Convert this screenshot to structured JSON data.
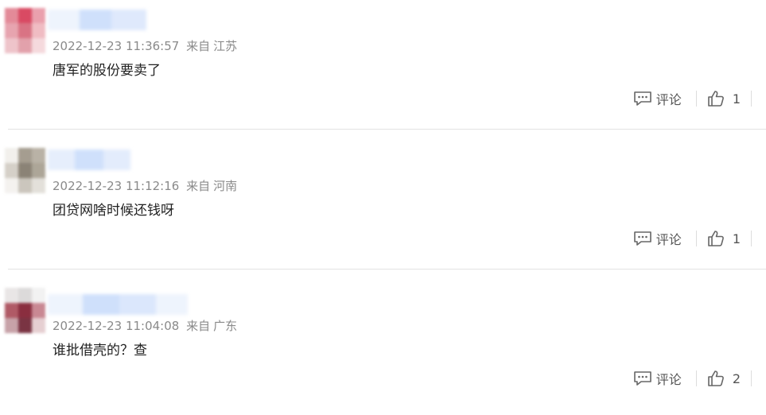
{
  "comments": [
    {
      "timestamp": "2022-12-23 11:36:57",
      "source_prefix": "来自",
      "location": "江苏",
      "text": "唐军的股份要卖了",
      "reply_label": "评论",
      "like_count": "1",
      "avatar_colors": [
        "#e38a98",
        "#d94a63",
        "#eaa0ad",
        "#e7a4af",
        "#d97384",
        "#f0bcc3",
        "#eec4ca",
        "#e2a1ab",
        "#f5d9dd"
      ]
    },
    {
      "timestamp": "2022-12-23 11:12:16",
      "source_prefix": "来自",
      "location": "河南",
      "text": "团贷网啥时候还钱呀",
      "reply_label": "评论",
      "like_count": "1",
      "avatar_colors": [
        "#f2f0ec",
        "#a59d90",
        "#b9b2a6",
        "#d5d0c8",
        "#8b8376",
        "#ada698",
        "#f4f2ef",
        "#cbc6bd",
        "#e3e0da"
      ]
    },
    {
      "timestamp": "2022-12-23 11:04:08",
      "source_prefix": "来自",
      "location": "广东",
      "text": "谁批借壳的？查",
      "reply_label": "评论",
      "like_count": "2",
      "avatar_colors": [
        "#e9e6e6",
        "#dcdada",
        "#f2f2f2",
        "#b05a66",
        "#8a2e3f",
        "#c98893",
        "#c7a2a8",
        "#7a3443",
        "#e6cfd2"
      ]
    }
  ],
  "colors": {
    "meta_text": "#8a8a8a",
    "content_text": "#222222",
    "action_text": "#555555",
    "divider": "#e2e2e2",
    "name_blur": "#cfe0fb"
  },
  "icons": {
    "reply": "comment-bubble-icon",
    "like": "thumbs-up-icon"
  }
}
